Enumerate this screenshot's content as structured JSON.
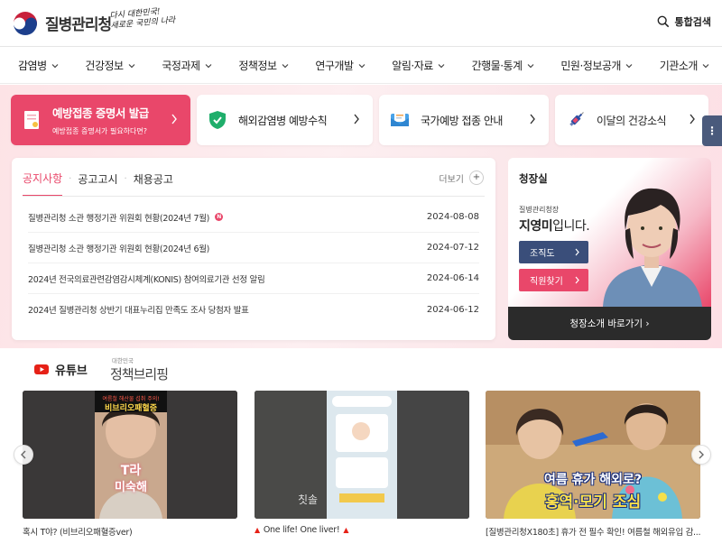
{
  "header": {
    "org_name": "질병관리청",
    "slogan_line1": "다시 대한민국!",
    "slogan_line2": "새로운 국민의 나라",
    "search_label": "통합검색"
  },
  "nav": [
    {
      "label": "감염병"
    },
    {
      "label": "건강정보"
    },
    {
      "label": "국정과제"
    },
    {
      "label": "정책정보"
    },
    {
      "label": "연구개발"
    },
    {
      "label": "알림·자료"
    },
    {
      "label": "간행물·통계"
    },
    {
      "label": "민원·정보공개"
    },
    {
      "label": "기관소개"
    }
  ],
  "quick": {
    "primary": {
      "label": "예방접종 증명서 발급",
      "sub": "예방접종 증명서가 필요하다면?"
    },
    "items": [
      {
        "label": "해외감염병 예방수칙",
        "icon": "shield-icon"
      },
      {
        "label": "국가예방 접종 안내",
        "icon": "mail-icon"
      },
      {
        "label": "이달의 건강소식",
        "icon": "syringe-icon"
      }
    ],
    "side_more": "⋮"
  },
  "notice": {
    "tabs": [
      "공지사항",
      "공고고시",
      "채용공고"
    ],
    "more_label": "더보기",
    "rows": [
      {
        "title": "질병관리청 소관 행정기관 위원회 현황(2024년 7월)",
        "date": "2024-08-08",
        "new": "N"
      },
      {
        "title": "질병관리청 소관 행정기관 위원회 현황(2024년 6월)",
        "date": "2024-07-12",
        "new": ""
      },
      {
        "title": "2024년 전국의료관련감염감시체계(KONIS) 참여의료기관 선정 알림",
        "date": "2024-06-14",
        "new": ""
      },
      {
        "title": "2024년 질병관리청 상반기 대표누리집 만족도 조사 당첨자 발표",
        "date": "2024-06-12",
        "new": ""
      }
    ]
  },
  "director": {
    "title": "청장실",
    "role": "질병관리청장",
    "name_bold": "지영미",
    "name_rest": "입니다.",
    "org_button": "조직도",
    "staff_button": "직원찾기",
    "footer_link": "청장소개 바로가기 ›"
  },
  "youtube": {
    "title": "유튜브",
    "briefing_small": "대한민국",
    "briefing_large": "정책브리핑",
    "videos": [
      {
        "caption": "혹시 T야? (비브리오패혈증ver)",
        "thumb_top": "여름철 해산물 섭취 주의!",
        "thumb_main": "비브리오패혈증",
        "thumb_bottom1": "T라",
        "thumb_bottom2": "미숙해"
      },
      {
        "caption": "One life! One liver!",
        "thumb_text": "칫솔"
      },
      {
        "caption": "[질병관리청X180초] 휴가 전 필수 확인! 여름철 해외유입 감...",
        "thumb_line1": "여름 휴가 해외로?",
        "thumb_line2": "홍역·모기 조심"
      }
    ]
  },
  "colors": {
    "accent": "#e9476a",
    "navy": "#3a4e7a",
    "dark": "#2b2b2b"
  }
}
